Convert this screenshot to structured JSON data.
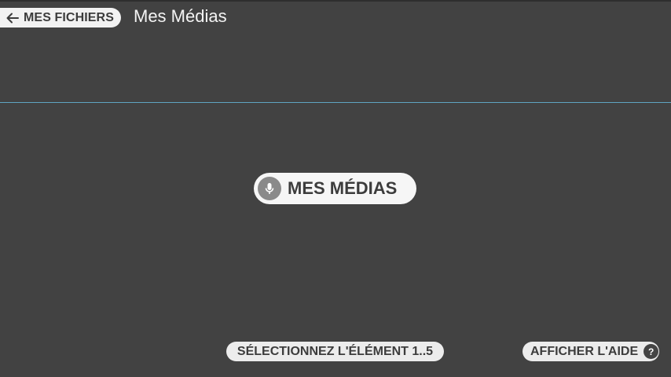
{
  "header": {
    "back_label": "MES FICHIERS",
    "title": "Mes Médias"
  },
  "main": {
    "voice_label": "MES MÉDIAS"
  },
  "footer": {
    "select_hint": "SÉLECTIONNEZ L'ÉLÉMENT 1..5",
    "help_label": "AFFICHER L'AIDE",
    "help_icon_glyph": "?"
  },
  "icons": {
    "back": "arrow-left-icon",
    "voice": "microphone-icon",
    "help": "question-mark-icon"
  },
  "colors": {
    "background": "#424242",
    "divider": "#5fa5c2",
    "pill": "#f2f2f2",
    "title_text": "#f4f4f4"
  }
}
